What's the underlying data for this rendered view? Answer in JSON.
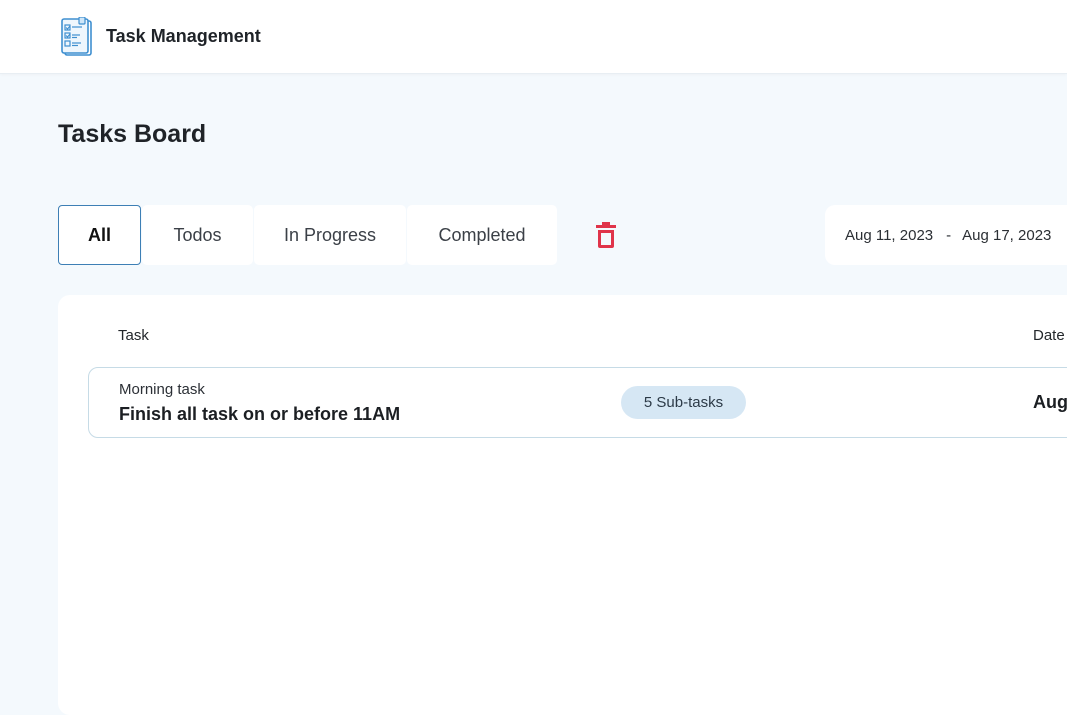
{
  "header": {
    "app_title": "Task Management",
    "logo_icon": "checklist-icon"
  },
  "page": {
    "title": "Tasks Board"
  },
  "tabs": [
    {
      "label": "All",
      "active": true
    },
    {
      "label": "Todos",
      "active": false
    },
    {
      "label": "In Progress",
      "active": false
    },
    {
      "label": "Completed",
      "active": false
    }
  ],
  "toolbar": {
    "delete_icon": "trash-icon",
    "delete_color": "#e0344a"
  },
  "date_range": {
    "start": "Aug 11, 2023",
    "separator": "-",
    "end": "Aug 17, 2023"
  },
  "table": {
    "columns": {
      "task": "Task",
      "date": "Date"
    },
    "rows": [
      {
        "category": "Morning task",
        "title": "Finish all task on or before 11AM",
        "subtasks": "5 Sub-tasks",
        "date": "Aug"
      }
    ]
  },
  "colors": {
    "accent": "#3d7fb5",
    "page_bg": "#f4f9fd",
    "badge_bg": "#d6e7f4"
  }
}
